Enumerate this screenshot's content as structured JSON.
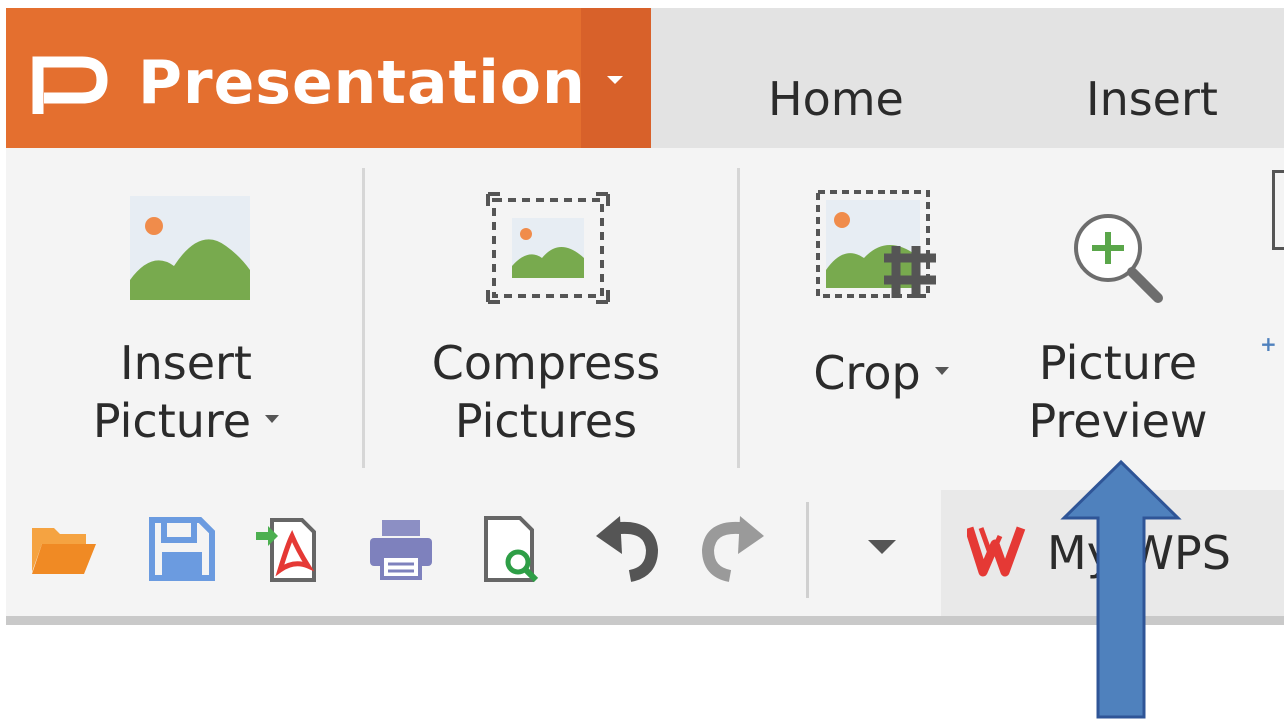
{
  "app": {
    "title": "Presentation",
    "brand_color": "#e46f2f",
    "logo_icon": "presentation-logo-icon"
  },
  "tabs": [
    {
      "label": "Home"
    },
    {
      "label": "Insert"
    }
  ],
  "ribbon": {
    "insert_picture": {
      "line1": "Insert",
      "line2": "Picture",
      "icon": "image-icon"
    },
    "compress_pictures": {
      "line1": "Compress",
      "line2": "Pictures",
      "icon": "compress-image-icon"
    },
    "crop": {
      "label": "Crop",
      "icon": "crop-icon"
    },
    "picture_preview": {
      "line1": "Picture",
      "line2": "Preview",
      "icon": "zoom-in-icon"
    }
  },
  "quick_access": {
    "icons": [
      "folder-open-icon",
      "save-icon",
      "export-pdf-icon",
      "print-icon",
      "print-preview-icon",
      "undo-icon",
      "redo-icon"
    ],
    "mywps_label": "My WPS"
  },
  "annotation": {
    "arrow_color": "#4f81bd",
    "points_to": "Picture Preview"
  }
}
